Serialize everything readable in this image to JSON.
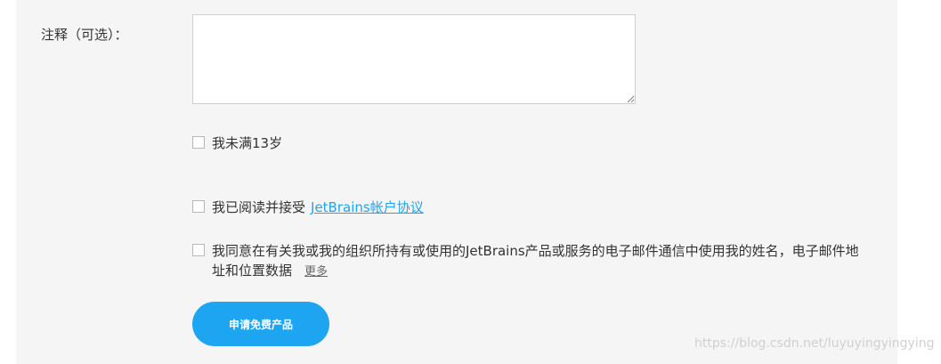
{
  "notes": {
    "label": "注释（可选）：",
    "value": "",
    "placeholder": ""
  },
  "age_check": {
    "label": "我未满13岁",
    "checked": false
  },
  "agreement_check": {
    "label": "我已阅读并接受",
    "link_text": "JetBrains帐户协议",
    "checked": false
  },
  "consent_check": {
    "label": "我同意在有关我或我的组织所持有或使用的JetBrains产品或服务的电子邮件通信中使用我的姓名，电子邮件地址和位置数据",
    "more_link": "更多",
    "checked": false
  },
  "submit": {
    "label": "申请免费产品"
  },
  "watermark": "https://blog.csdn.net/luyuyingyingying",
  "colors": {
    "accent": "#1ea5f2",
    "link": "#1fa4ef",
    "panel_background": "#f5f5f5"
  }
}
